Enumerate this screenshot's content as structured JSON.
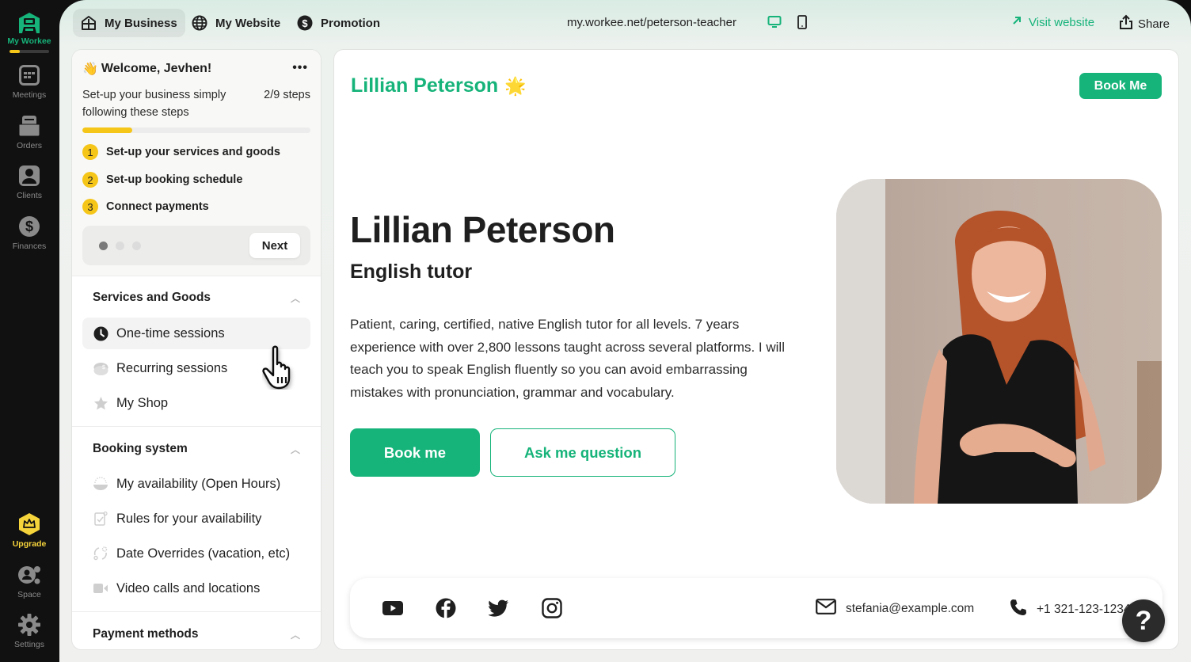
{
  "rail": {
    "brand": {
      "label": "My Workee",
      "progress": 0.25
    },
    "items": [
      {
        "label": "Meetings",
        "icon": "calendar-icon"
      },
      {
        "label": "Orders",
        "icon": "folder-icon"
      },
      {
        "label": "Clients",
        "icon": "user-icon"
      },
      {
        "label": "Finances",
        "icon": "dollar-icon"
      }
    ],
    "bottom": [
      {
        "label": "Upgrade",
        "icon": "crown-icon"
      },
      {
        "label": "Space",
        "icon": "space-icon"
      },
      {
        "label": "Settings",
        "icon": "gear-icon"
      }
    ]
  },
  "topbar": {
    "tabs": [
      {
        "label": "My Business",
        "icon": "house-icon",
        "active": true
      },
      {
        "label": "My Website",
        "icon": "globe-icon",
        "active": false
      },
      {
        "label": "Promotion",
        "icon": "dollar-circle-icon",
        "active": false
      }
    ],
    "url": "my.workee.net/peterson-teacher",
    "visit_label": "Visit website",
    "share_label": "Share"
  },
  "welcome": {
    "title": "Welcome, Jevhen!",
    "emoji": "👋",
    "subtitle": "Set-up your business simply following these steps",
    "steps_count": "2/9 steps",
    "progress": 0.22,
    "steps": [
      {
        "num": "1",
        "label": "Set-up your services and goods"
      },
      {
        "num": "2",
        "label": "Set-up booking schedule"
      },
      {
        "num": "3",
        "label": "Connect payments"
      }
    ],
    "next_label": "Next"
  },
  "sections": [
    {
      "title": "Services and Goods",
      "items": [
        {
          "label": "One-time sessions",
          "icon": "clock-icon",
          "active": true
        },
        {
          "label": "Recurring sessions",
          "icon": "recurring-icon",
          "active": false
        },
        {
          "label": "My Shop",
          "icon": "star-icon",
          "active": false
        }
      ]
    },
    {
      "title": "Booking system",
      "items": [
        {
          "label": "My availability (Open Hours)",
          "icon": "sunrise-icon"
        },
        {
          "label": "Rules for your availability",
          "icon": "rules-icon"
        },
        {
          "label": "Date Overrides (vacation, etc)",
          "icon": "override-icon"
        },
        {
          "label": "Video calls and locations",
          "icon": "video-icon"
        }
      ]
    },
    {
      "title": "Payment methods",
      "items": []
    }
  ],
  "preview": {
    "brand_name": "Lillian Peterson",
    "brand_emoji": "🌟",
    "book_top_label": "Book Me",
    "name": "Lillian Peterson",
    "role": "English tutor",
    "bio": "Patient, caring, certified, native English tutor for all levels. 7 years experience with over 2,800 lessons taught across several platforms. I will teach you to speak English fluently so you can avoid embarrassing mistakes with pronunciation, grammar and vocabulary.",
    "book_label": "Book me",
    "ask_label": "Ask me question",
    "photo_alt": "Smiling woman with long red hair in a black sleeveless top",
    "socials": [
      "youtube-icon",
      "facebook-icon",
      "twitter-icon",
      "instagram-icon"
    ],
    "email": "stefania@example.com",
    "phone": "+1 321-123-1234"
  },
  "help_label": "?",
  "colors": {
    "accent": "#16b37a",
    "progress": "#f5c518",
    "rail": "#111111"
  }
}
